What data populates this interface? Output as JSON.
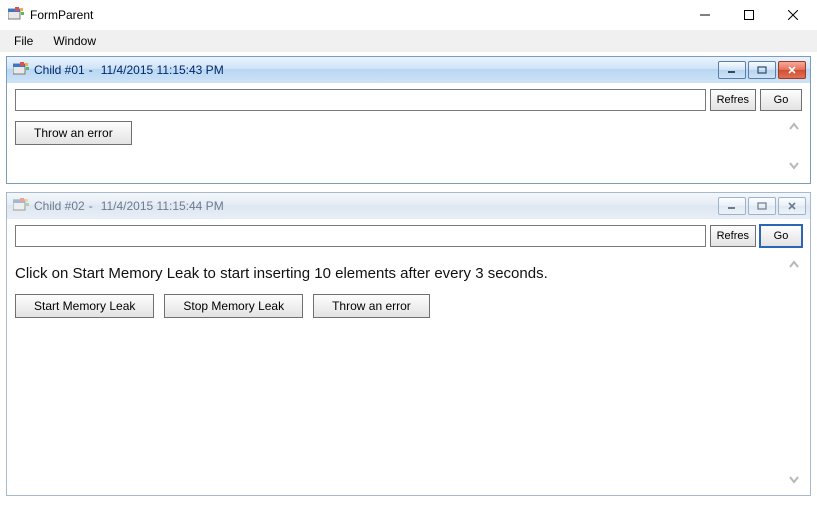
{
  "main_window": {
    "title": "FormParent"
  },
  "menubar": {
    "items": [
      "File",
      "Window"
    ]
  },
  "buttons": {
    "refresh": "Refres",
    "go": "Go"
  },
  "children": [
    {
      "title": "Child #01",
      "timestamp": "11/4/2015 11:15:43 PM",
      "active": true,
      "url": "",
      "content_text": "",
      "actions": {
        "throw": "Throw an error"
      }
    },
    {
      "title": "Child #02",
      "timestamp": "11/4/2015 11:15:44 PM",
      "active": false,
      "url": "",
      "content_text": "Click on Start Memory Leak to start inserting 10 elements after every 3 seconds.",
      "actions": {
        "start": "Start Memory Leak",
        "stop": "Stop  Memory Leak",
        "throw": "Throw an error"
      }
    }
  ]
}
